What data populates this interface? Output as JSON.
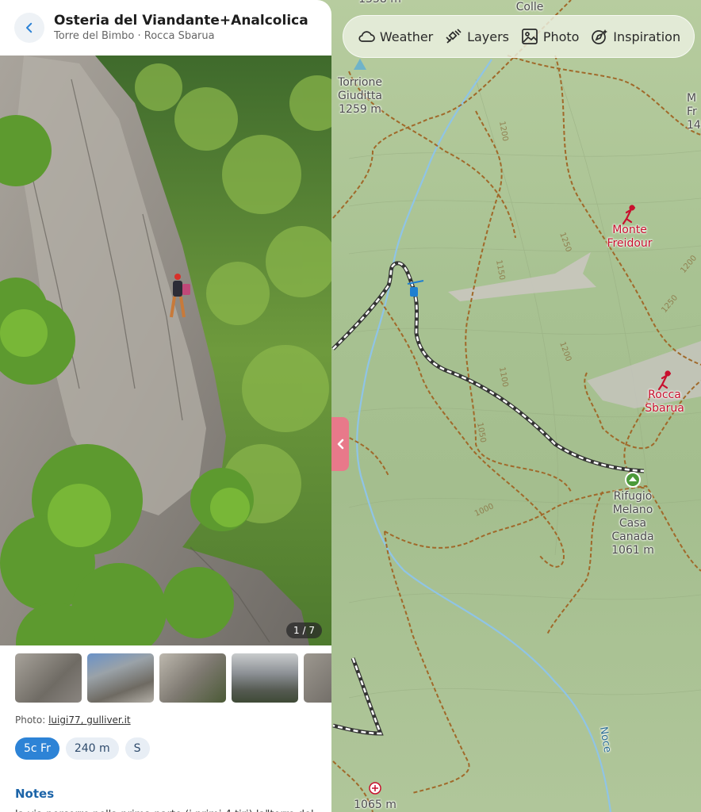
{
  "map": {
    "labels": [
      {
        "name": "torrione-giuditta",
        "text": "Torrione\nGiuditta\n1259 m"
      },
      {
        "name": "monte-freidour",
        "text": "Monte\nFreidour"
      },
      {
        "name": "rocca-sbarua",
        "text": "Rocca\nSbarua"
      },
      {
        "name": "rifugio-melano",
        "text": "Rifugio\nMelano\nCasa\nCanada\n1061 m"
      },
      {
        "name": "elevation-1065",
        "text": "1065 m"
      },
      {
        "name": "top-left-elev",
        "text": "1358 m"
      },
      {
        "name": "colle",
        "text": "Colle"
      },
      {
        "name": "right-edge",
        "text": "M\nFr\n14"
      }
    ],
    "contours": [
      "1250",
      "1200",
      "1250",
      "1200",
      "1150",
      "1100",
      "1000",
      "1200",
      "1050"
    ],
    "river": "Noce",
    "colors": {
      "trail": "#a0692a",
      "route": "#ffffff",
      "water": "#8fc4e6",
      "peak": "#c8102e"
    }
  },
  "toolbar": {
    "weather": "Weather",
    "layers": "Layers",
    "photo": "Photo",
    "inspiration": "Inspiration"
  },
  "panel": {
    "title": "Osteria del Viandante+Analcolica",
    "subtitle": "Torre del Bimbo · Rocca Sbarua",
    "photo_counter": "1 / 7",
    "credit_prefix": "Photo: ",
    "credit_link": "luigi77, gulliver.it",
    "tags": [
      "5c Fr",
      "240 m",
      "S"
    ],
    "notes_heading": "Notes",
    "notes_text": "la via percorre nella prima parte (i primi 4 tiri) la\"torre del"
  },
  "icons": {
    "back": "chevron-left-icon",
    "weather": "cloud-icon",
    "layers": "satellite-icon",
    "photo": "image-icon",
    "inspiration": "compass-icon",
    "collapse": "chevron-left-icon"
  }
}
